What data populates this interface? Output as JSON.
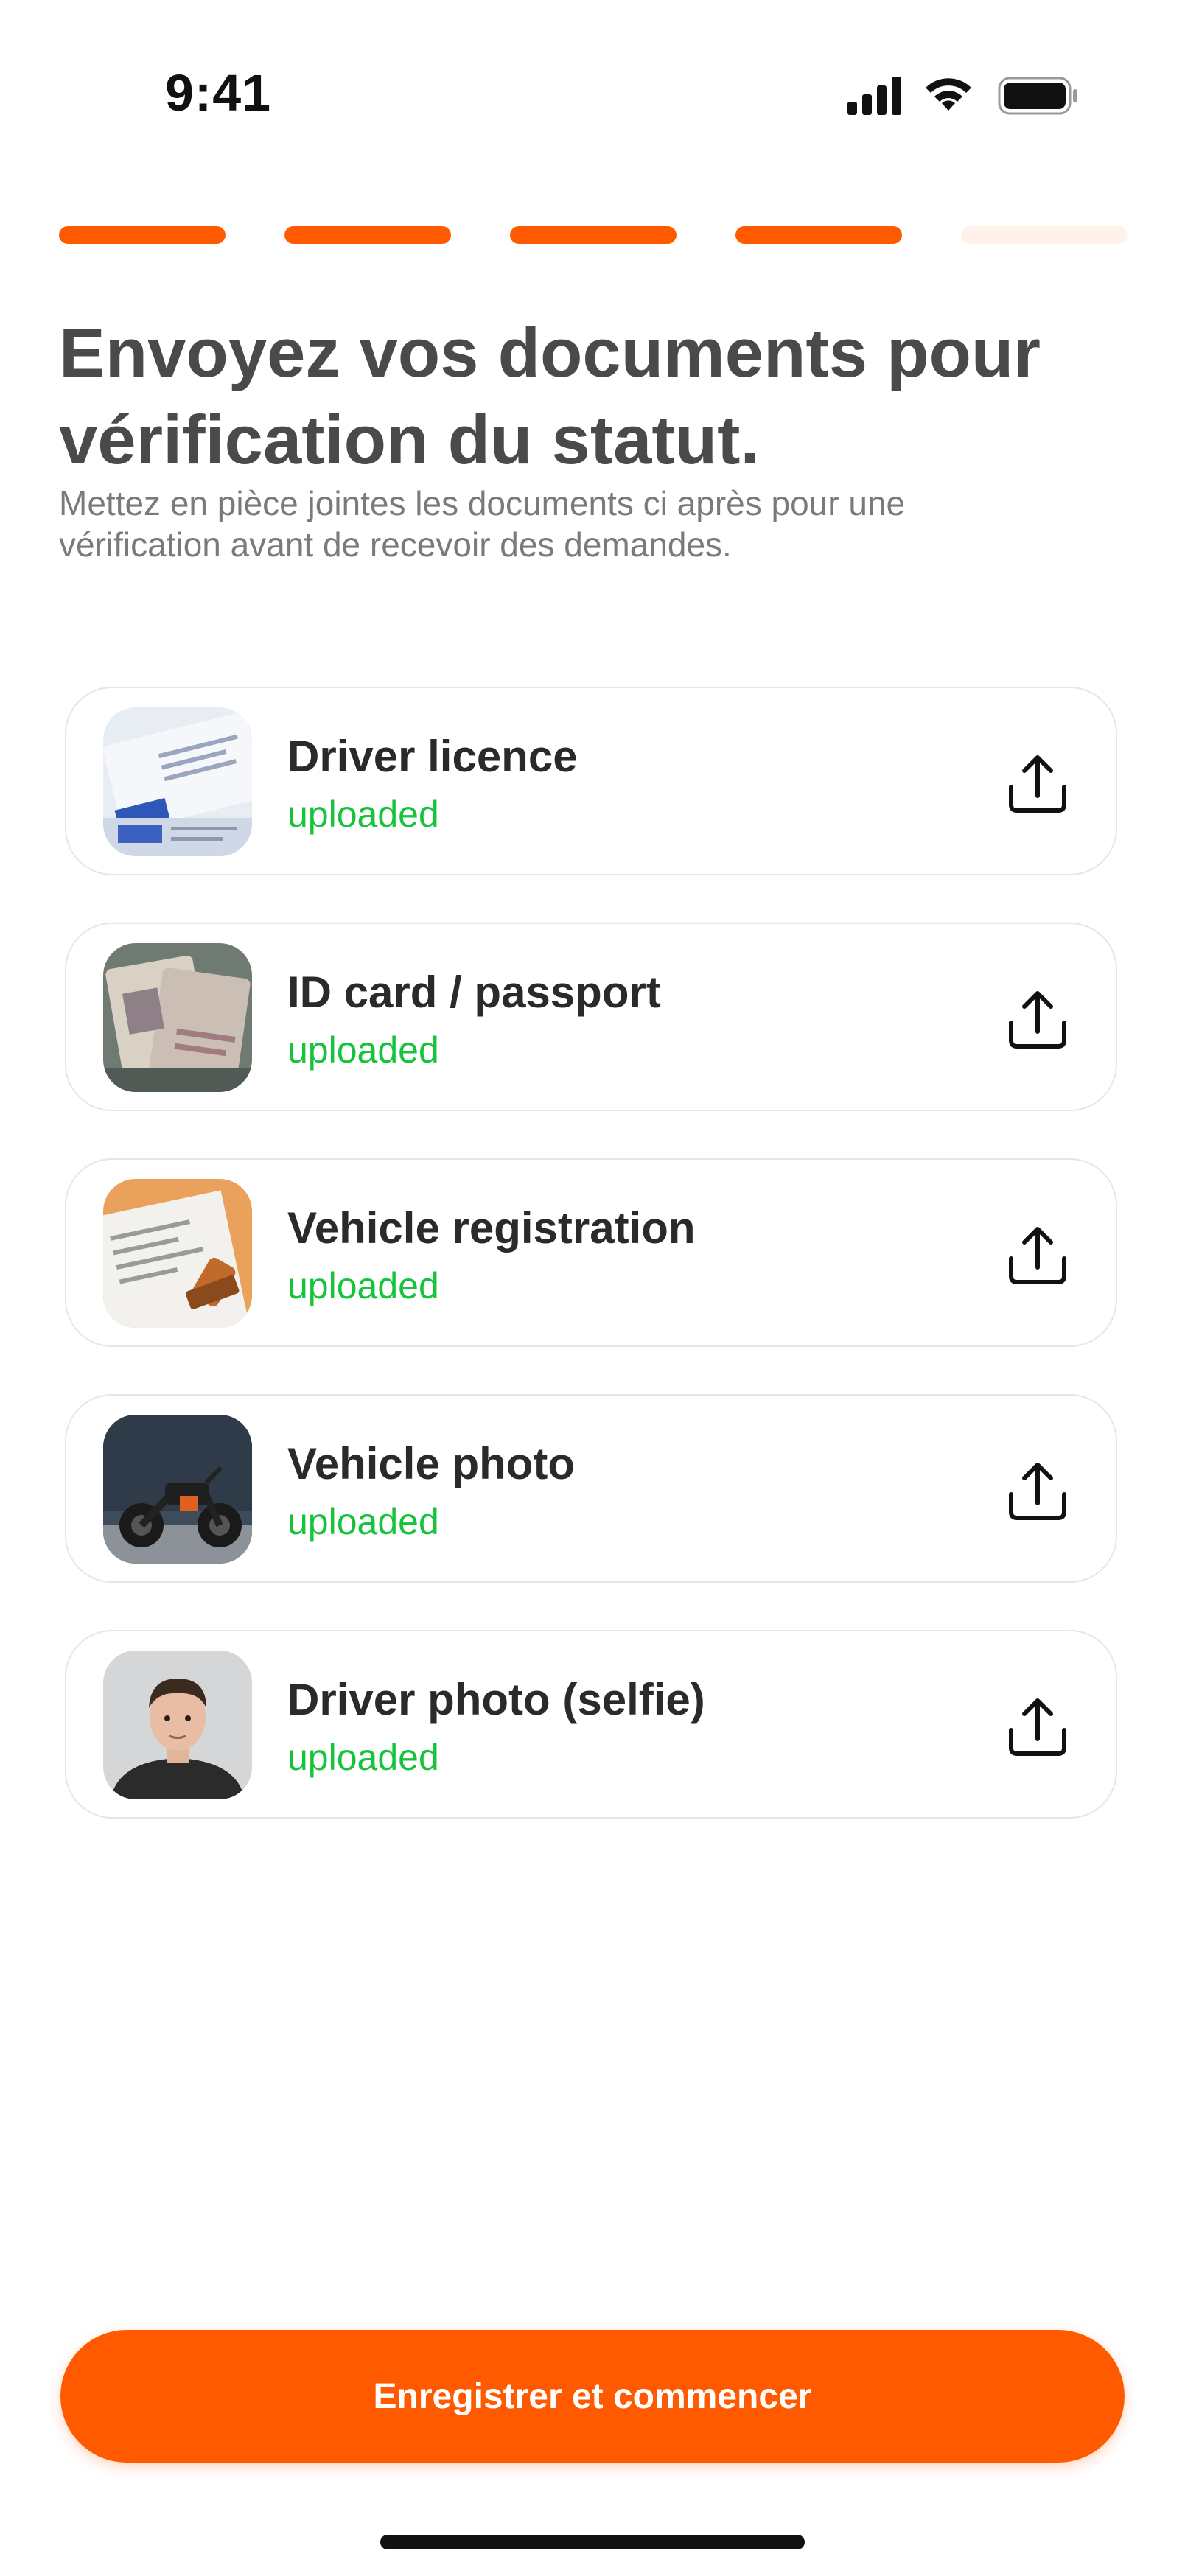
{
  "status_bar": {
    "time": "9:41",
    "icons": [
      "cellular-signal-icon",
      "wifi-icon",
      "battery-icon"
    ]
  },
  "progress": {
    "total_steps": 5,
    "completed_steps": 4,
    "active_color": "#ff5a00",
    "inactive_color": "#fff2ea"
  },
  "header": {
    "title": "Envoyez vos documents pour vérification du statut.",
    "subtitle": "Mettez en pièce jointes les documents ci après pour une vérification avant de recevoir des demandes."
  },
  "documents": [
    {
      "name": "Driver licence",
      "status": "uploaded",
      "thumbnail": "driver-licence-photo",
      "action_icon": "upload-icon"
    },
    {
      "name": "ID card / passport",
      "status": "uploaded",
      "thumbnail": "passport-photo",
      "action_icon": "upload-icon"
    },
    {
      "name": "Vehicle registration",
      "status": "uploaded",
      "thumbnail": "registration-document-photo",
      "action_icon": "upload-icon"
    },
    {
      "name": "Vehicle photo",
      "status": "uploaded",
      "thumbnail": "motorcycle-photo",
      "action_icon": "upload-icon"
    },
    {
      "name": "Driver photo (selfie)",
      "status": "uploaded",
      "thumbnail": "selfie-portrait-photo",
      "action_icon": "upload-icon"
    }
  ],
  "colors": {
    "accent": "#ff5a00",
    "status_uploaded": "#16c33b",
    "title": "#4a4a4a",
    "subtitle": "#7a7a7a"
  },
  "cta": {
    "label": "Enregistrer et commencer"
  }
}
